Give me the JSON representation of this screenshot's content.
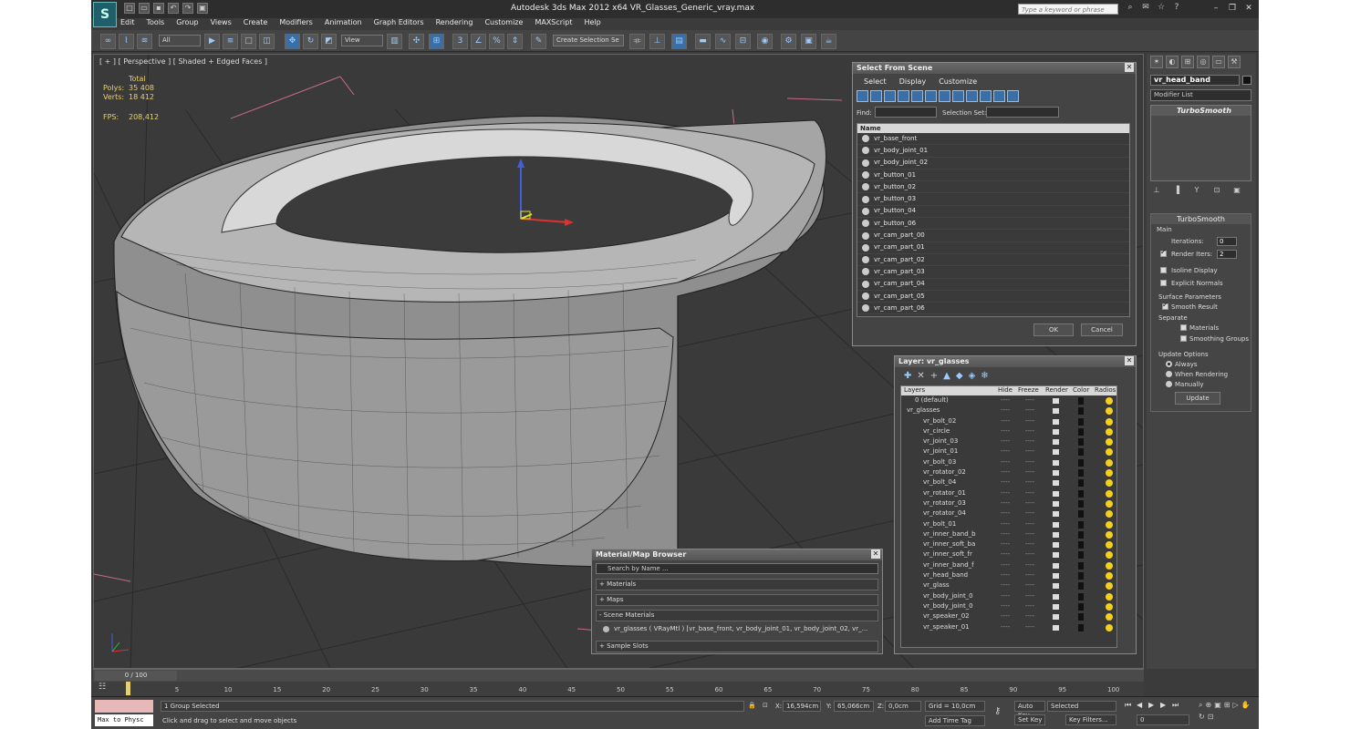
{
  "window": {
    "title": "Autodesk 3ds Max  2012 x64     VR_Glasses_Generic_vray.max",
    "search_placeholder": "Type a keyword or phrase"
  },
  "menu": [
    "Edit",
    "Tools",
    "Group",
    "Views",
    "Create",
    "Modifiers",
    "Animation",
    "Graph Editors",
    "Rendering",
    "Customize",
    "MAXScript",
    "Help"
  ],
  "toolbar": {
    "filter_value": "All",
    "ref_coord_value": "View",
    "selection_set_placeholder": "Create Selection Se"
  },
  "viewport": {
    "label": "[ + ] [ Perspective ] [ Shaded + Edged Faces ]",
    "stats": {
      "total_label": "Total",
      "polys_label": "Polys:",
      "polys_value": "35 408",
      "verts_label": "Verts:",
      "verts_value": "18 412",
      "fps_label": "FPS:",
      "fps_value": "208,412"
    }
  },
  "select_from_scene": {
    "title": "Select From Scene",
    "menu": [
      "Select",
      "Display",
      "Customize"
    ],
    "find_label": "Find:",
    "selection_set_label": "Selection Set:",
    "name_header": "Name",
    "items": [
      "vr_base_front",
      "vr_body_joint_01",
      "vr_body_joint_02",
      "vr_button_01",
      "vr_button_02",
      "vr_button_03",
      "vr_button_04",
      "vr_button_06",
      "vr_cam_part_00",
      "vr_cam_part_01",
      "vr_cam_part_02",
      "vr_cam_part_03",
      "vr_cam_part_04",
      "vr_cam_part_05",
      "vr_cam_part_06"
    ],
    "ok_label": "OK",
    "cancel_label": "Cancel"
  },
  "layer_dialog": {
    "title": "Layer: vr_glasses",
    "headers": [
      "Layers",
      "Hide",
      "Freeze",
      "Render",
      "Color",
      "Radios"
    ],
    "rows": [
      {
        "name": "0 (default)",
        "indent": 1
      },
      {
        "name": "vr_glasses",
        "indent": 0
      },
      {
        "name": "vr_bolt_02",
        "indent": 2
      },
      {
        "name": "vr_circle",
        "indent": 2
      },
      {
        "name": "vr_joint_03",
        "indent": 2
      },
      {
        "name": "vr_joint_01",
        "indent": 2
      },
      {
        "name": "vr_bolt_03",
        "indent": 2
      },
      {
        "name": "vr_rotator_02",
        "indent": 2
      },
      {
        "name": "vr_bolt_04",
        "indent": 2
      },
      {
        "name": "vr_rotator_01",
        "indent": 2
      },
      {
        "name": "vr_rotator_03",
        "indent": 2
      },
      {
        "name": "vr_rotator_04",
        "indent": 2
      },
      {
        "name": "vr_bolt_01",
        "indent": 2
      },
      {
        "name": "vr_inner_band_b",
        "indent": 2
      },
      {
        "name": "vr_inner_soft_ba",
        "indent": 2
      },
      {
        "name": "vr_inner_soft_fr",
        "indent": 2
      },
      {
        "name": "vr_inner_band_f",
        "indent": 2
      },
      {
        "name": "vr_head_band",
        "indent": 2
      },
      {
        "name": "vr_glass",
        "indent": 2
      },
      {
        "name": "vr_body_joint_0",
        "indent": 2
      },
      {
        "name": "vr_body_joint_0",
        "indent": 2
      },
      {
        "name": "vr_speaker_02",
        "indent": 2
      },
      {
        "name": "vr_speaker_01",
        "indent": 2
      }
    ]
  },
  "material_browser": {
    "title": "Material/Map Browser",
    "search_placeholder": "Search by Name ...",
    "groups": [
      "+ Materials",
      "+ Maps",
      "- Scene Materials"
    ],
    "scene_material": "vr_glasses  ( VRayMtl ) [vr_base_front, vr_body_joint_01, vr_body_joint_02, vr_...",
    "sample_slots": "+ Sample Slots"
  },
  "command_panel": {
    "object_name": "vr_head_band",
    "modifier_list": "Modifier List",
    "stack_item": "TurboSmooth",
    "rollout_title": "TurboSmooth",
    "main_label": "Main",
    "iterations_label": "Iterations:",
    "iterations_value": "0",
    "render_iters_label": "Render Iters:",
    "render_iters_value": "2",
    "isoline_label": "Isoline Display",
    "explicit_label": "Explicit Normals",
    "surface_label": "Surface Parameters",
    "smooth_result_label": "Smooth Result",
    "separate_label": "Separate",
    "materials_label": "Materials",
    "smoothing_groups_label": "Smoothing Groups",
    "update_options_label": "Update Options",
    "always_label": "Always",
    "when_rendering_label": "When Rendering",
    "manually_label": "Manually",
    "update_button": "Update"
  },
  "timeline": {
    "frame": "0 / 100",
    "ticks": [
      "0",
      "5",
      "10",
      "15",
      "20",
      "25",
      "30",
      "35",
      "40",
      "45",
      "50",
      "55",
      "60",
      "65",
      "70",
      "75",
      "80",
      "85",
      "90",
      "95",
      "100"
    ]
  },
  "status": {
    "maxscript": "Max to Physc",
    "selection": "1 Group Selected",
    "prompt": "Click and drag to select and move objects",
    "x_label": "X:",
    "x_value": "16,594cm",
    "y_label": "Y:",
    "y_value": "65,066cm",
    "z_label": "Z:",
    "z_value": "0,0cm",
    "grid": "Grid = 10,0cm",
    "add_time_tag": "Add Time Tag",
    "auto_key": "Auto Key",
    "set_key": "Set Key",
    "selected": "Selected",
    "key_filters": "Key Filters...",
    "frame_value": "0"
  }
}
